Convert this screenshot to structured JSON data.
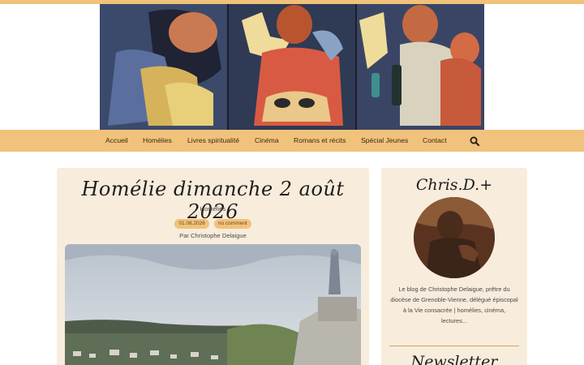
{
  "colors": {
    "accent": "#f1c27b",
    "card_bg": "#f8ecdc"
  },
  "nav": {
    "items": [
      {
        "label": "Accueil"
      },
      {
        "label": "Homélies"
      },
      {
        "label": "Livres spiritualité"
      },
      {
        "label": "Cinéma"
      },
      {
        "label": "Romans et récits"
      },
      {
        "label": "Spécial Jeunes"
      },
      {
        "label": "Contact"
      }
    ],
    "search_icon": "search-icon"
  },
  "post": {
    "title": "Homélie dimanche 2 août 2026",
    "category": "Homélies",
    "date": "01.08.2026",
    "comments": "no comment",
    "author": "Par Christophe Delaigue"
  },
  "sidebar": {
    "title": "Chris.D.+",
    "description": "Le blog de Christophe Delaigue, prêtre du diocèse de Grenoble-Vienne, délégué épiscopal à la Vie consacrée | homélies, cinéma, lectures...",
    "newsletter_title": "Newsletter"
  }
}
